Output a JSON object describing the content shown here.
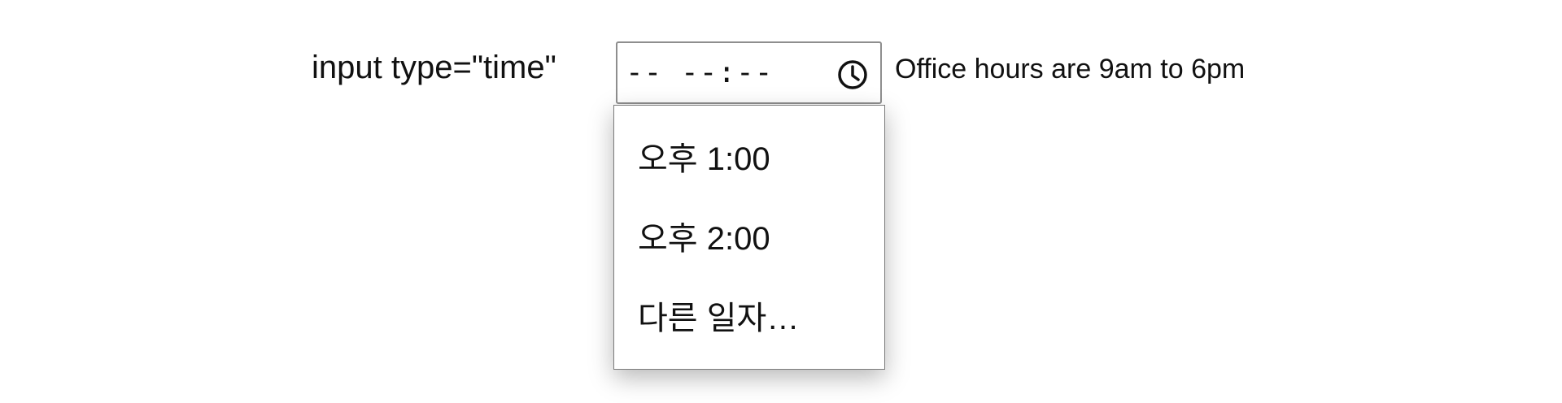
{
  "field": {
    "label": "input type=\"time\"",
    "value": "-- --:--",
    "icon": "clock-icon"
  },
  "hint": "Office hours are 9am to 6pm",
  "dropdown": {
    "options": [
      {
        "label": "오후 1:00"
      },
      {
        "label": "오후 2:00"
      },
      {
        "label": "다른 일자…"
      }
    ]
  }
}
